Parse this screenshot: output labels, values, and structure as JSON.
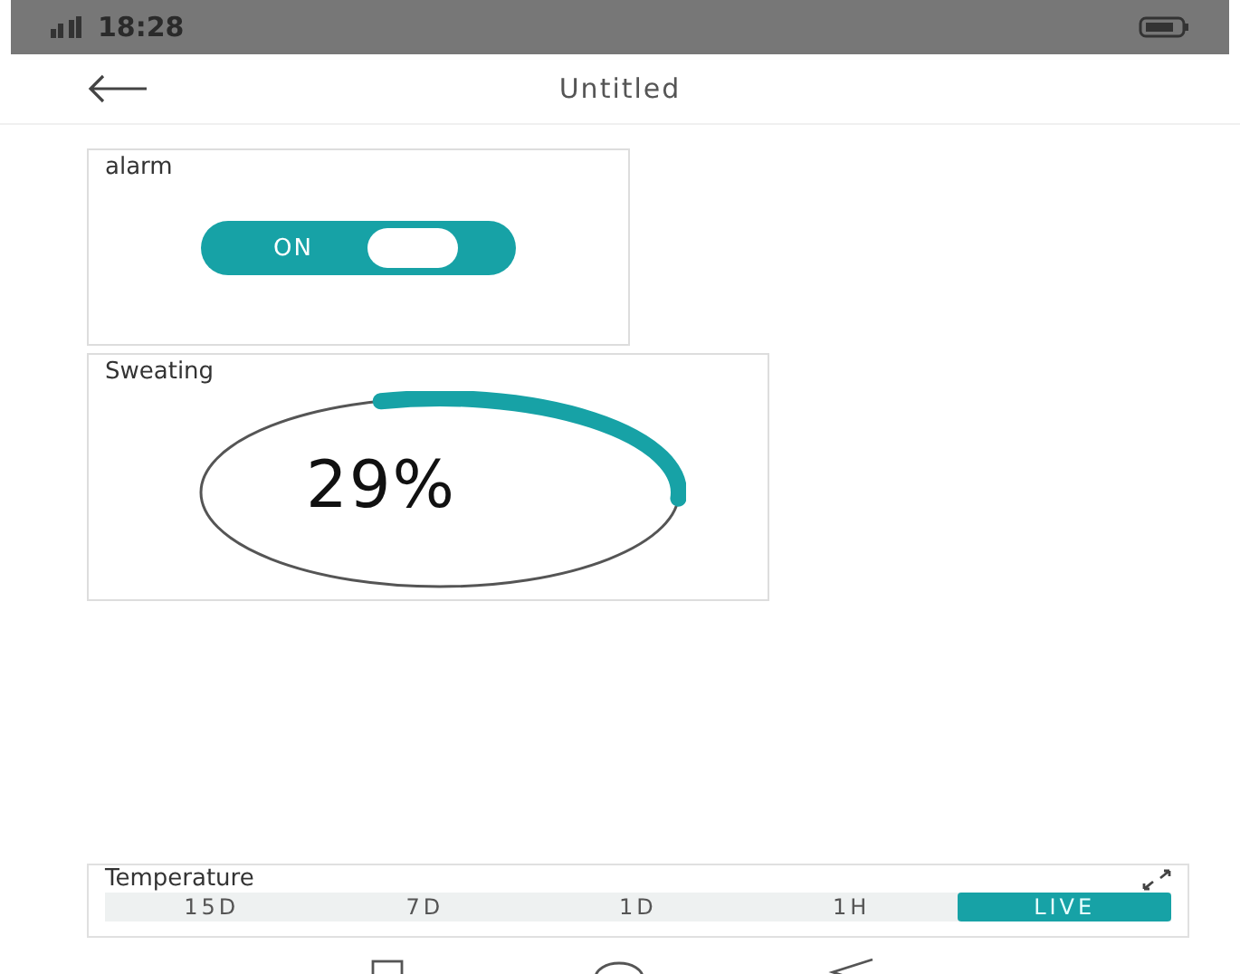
{
  "status_bar": {
    "time": "18:28"
  },
  "header": {
    "title": "Untitled"
  },
  "widgets": [
    {
      "kind": "switch",
      "title": "alarm",
      "label": "ON",
      "on": true
    },
    {
      "kind": "gauge",
      "title": "Sweating",
      "reading": "29%"
    }
  ],
  "chart_widget": {
    "title": "Temperature",
    "ranges": [
      {
        "label": "15D",
        "selected": false
      },
      {
        "label": "7D",
        "selected": false
      },
      {
        "label": "1D",
        "selected": false
      },
      {
        "label": "1H",
        "selected": false
      },
      {
        "label": "LIVE",
        "selected": true
      }
    ]
  }
}
